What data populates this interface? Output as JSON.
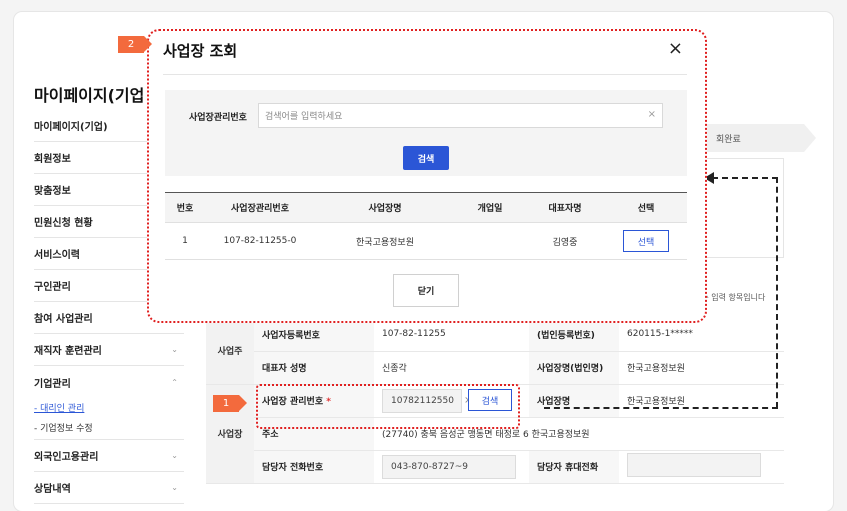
{
  "sidebar": {
    "title": "마이페이지(기업",
    "items": [
      {
        "label": "마이페이지(기업)",
        "chevron": ""
      },
      {
        "label": "회원정보",
        "chevron": ""
      },
      {
        "label": "맞춤정보",
        "chevron": ""
      },
      {
        "label": "민원신청 현황",
        "chevron": ""
      },
      {
        "label": "서비스이력",
        "chevron": ""
      },
      {
        "label": "구인관리",
        "chevron": ""
      },
      {
        "label": "참여 사업관리",
        "chevron": ""
      },
      {
        "label": "재직자 훈련관리",
        "chevron": "⌄"
      },
      {
        "label": "기업관리",
        "chevron": "⌃"
      }
    ],
    "subitems": [
      "- 대리인 관리",
      "- 기업정보 수정"
    ],
    "items_after": [
      {
        "label": "외국인고용관리",
        "chevron": "⌄"
      },
      {
        "label": "상담내역",
        "chevron": "⌄"
      }
    ]
  },
  "background": {
    "status_step": "회완료",
    "required_note": "필수 입력 항목입니다",
    "rows": {
      "biz_reg_label": "사업자등록번호",
      "biz_reg_value": "107-82-11255",
      "corp_reg_label": "(법인등록번호)",
      "corp_reg_value": "620115-1*****",
      "group_owner": "사업주",
      "rep_label": "대표자 성명",
      "rep_value": "신종각",
      "biz_name_label": "사업장명(법인명)",
      "biz_name_value": "한국고용정보원",
      "group_site": "사업장",
      "site_no_label": "사업장 관리번호",
      "required_mark": "*",
      "site_no_value": "10782112550",
      "search_label": "검색",
      "site_name_label": "사업장명",
      "site_name_value": "한국고용정보원",
      "addr_label": "주소",
      "addr_value": "(27740) 충북 음성군 맹동면 태정로 6 한국고용정보원",
      "phone_label": "담당자 전화번호",
      "phone_value": "043-870-8727~9",
      "mobile_label": "담당자 휴대전화"
    }
  },
  "badges": {
    "one": "1",
    "two": "2"
  },
  "modal": {
    "title": "사업장 조회",
    "close_icon": "×",
    "search_label": "사업장관리번호",
    "search_placeholder": "검색어를 입력하세요",
    "clear_icon": "×",
    "search_button": "검색",
    "columns": [
      "번호",
      "사업장관리번호",
      "사업장명",
      "개업일",
      "대표자명",
      "선택"
    ],
    "results": [
      {
        "no": "1",
        "site_no": "107-82-11255-0",
        "name": "한국고용정보원",
        "open_date": "",
        "rep": "김영중",
        "select": "선택"
      }
    ],
    "close_button": "닫기"
  }
}
